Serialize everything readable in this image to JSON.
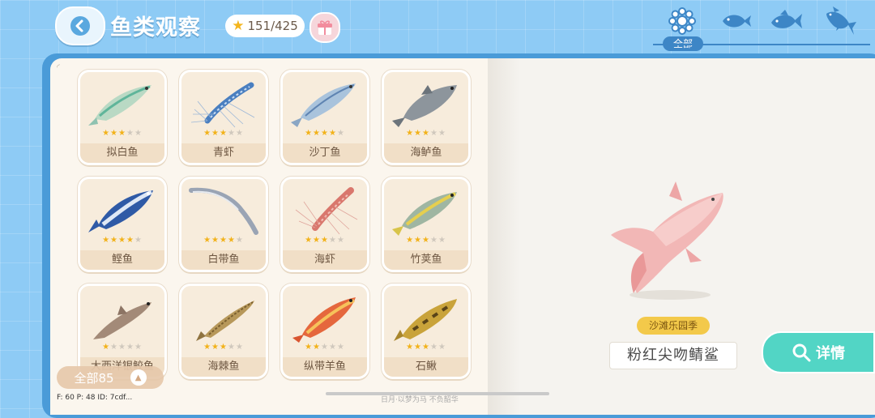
{
  "header": {
    "title": "鱼类观察",
    "star_count": "151/425"
  },
  "filters": {
    "all_label": "全部",
    "icons": [
      "all-icon",
      "small-fish-icon",
      "medium-fish-icon",
      "large-fish-icon"
    ]
  },
  "fish_cards": [
    {
      "name": "拟白鱼",
      "stars": 3
    },
    {
      "name": "青虾",
      "stars": 3
    },
    {
      "name": "沙丁鱼",
      "stars": 4
    },
    {
      "name": "海鲈鱼",
      "stars": 3
    },
    {
      "name": "鲣鱼",
      "stars": 4
    },
    {
      "name": "白带鱼",
      "stars": 4
    },
    {
      "name": "海虾",
      "stars": 3
    },
    {
      "name": "竹荚鱼",
      "stars": 3
    },
    {
      "name": "大西洋银鲛鱼",
      "stars": 1
    },
    {
      "name": "海棘鱼",
      "stars": 3
    },
    {
      "name": "纵带羊鱼",
      "stars": 2
    },
    {
      "name": "石鳅",
      "stars": 3
    }
  ],
  "footer": {
    "all_count_label": "全部85",
    "debug": "F: 60    P: 48    ID: 7cdf...",
    "watermark": "日月·以梦为马 不负韶华"
  },
  "detail": {
    "season": "沙滩乐园季",
    "fish_name": "粉红尖吻鲭鲨",
    "detail_button": "详情"
  },
  "colors": {
    "background": "#8ecbf5",
    "book_frame": "#4a9bd8",
    "star_on": "#f2b21a",
    "detail_button": "#52d5c5",
    "season_badge": "#f3c94a"
  }
}
